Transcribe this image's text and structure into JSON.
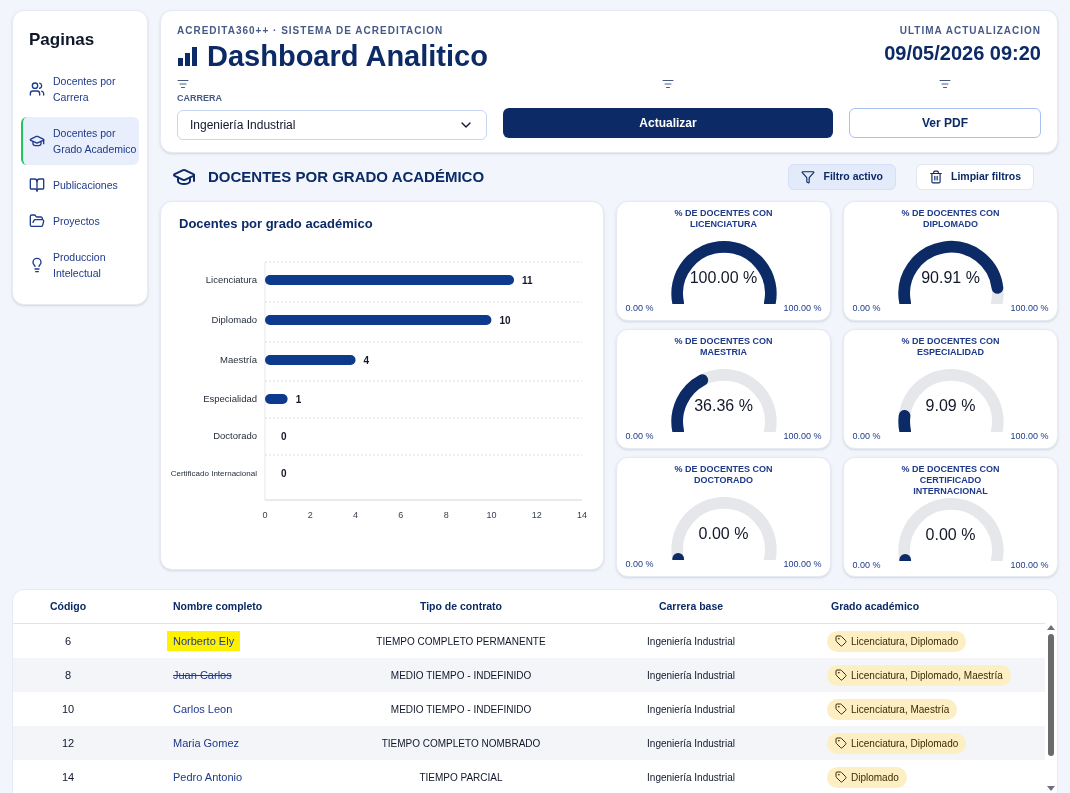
{
  "sidebar": {
    "title": "Paginas",
    "items": [
      {
        "label": "Docentes por Carrera",
        "selected": false
      },
      {
        "label": "Docentes por Grado Academico",
        "selected": true
      },
      {
        "label": "Publicaciones",
        "selected": false
      },
      {
        "label": "Proyectos",
        "selected": false
      },
      {
        "label": "Produccion Intelectual",
        "selected": false
      }
    ]
  },
  "header": {
    "subtitle": "ACREDITA360++ · SISTEMA DE ACREDITACION",
    "title": "Dashboard Analitico",
    "update_label": "ULTIMA ACTUALIZACION",
    "update_value": "09/05/2026 09:20",
    "filter_label": "CARRERA",
    "filter_value": "Ingeniería Industrial",
    "buttons": [
      {
        "label": "Actualizar",
        "kind": "primary"
      },
      {
        "label": "Ver PDF",
        "kind": "outline"
      }
    ]
  },
  "section": {
    "title": "DOCENTES POR GRADO ACADÉMICO",
    "buttons": [
      {
        "label": "Filtro activo",
        "kind": "filter",
        "selected": true
      },
      {
        "label": "Limpiar filtros",
        "kind": "trash",
        "selected": false
      }
    ]
  },
  "bar_chart": {
    "chart_data": {
      "type": "bar",
      "title": "Docentes por grado académico",
      "orientation": "horizontal",
      "categories": [
        "Licenciatura",
        "Diplomado",
        "Maestría",
        "Especialidad",
        "Doctorado",
        "Certificado Internacional"
      ],
      "series": [
        {
          "color": "#0d3a8c",
          "values": [
            11,
            10,
            4,
            1,
            0,
            0
          ]
        }
      ],
      "xlim": [
        0,
        14
      ],
      "xticks": [
        0,
        2,
        4,
        6,
        8,
        10,
        12,
        14
      ],
      "data_labels": true
    }
  },
  "gauges": [
    {
      "title": "% DE DOCENTES CON LICENCIATURA",
      "value": "100.00 %",
      "min": "0.00 %",
      "max": "100.00 %"
    },
    {
      "title": "% DE DOCENTES CON DIPLOMADO",
      "value": "90.91 %",
      "min": "0.00 %",
      "max": "100.00 %"
    },
    {
      "title": "% DE DOCENTES CON MAESTRIA",
      "value": "36.36 %",
      "min": "0.00 %",
      "max": "100.00 %"
    },
    {
      "title": "% DE DOCENTES CON ESPECIALIDAD",
      "value": "9.09 %",
      "min": "0.00 %",
      "max": "100.00 %"
    },
    {
      "title": "% DE DOCENTES CON DOCTORADO",
      "value": "0.00 %",
      "min": "0.00 %",
      "max": "100.00 %"
    },
    {
      "title": "% DE DOCENTES CON CERTIFICADO INTERNACIONAL",
      "value": "0.00 %",
      "min": "0.00 %",
      "max": "100.00 %"
    }
  ],
  "table": {
    "columns": [
      "Código",
      "Nombre completo",
      "Tipo de contrato",
      "Carrera base",
      "Grado académico"
    ],
    "rows": [
      {
        "code": "6",
        "name": "Norberto Ely",
        "highlighted": true,
        "struck": false,
        "contract": "TIEMPO COMPLETO PERMANENTE",
        "career": "Ingeniería Industrial",
        "degrees": "Licenciatura, Diplomado"
      },
      {
        "code": "8",
        "name": "Juan Carlos",
        "highlighted": false,
        "struck": true,
        "contract": "MEDIO TIEMPO - INDEFINIDO",
        "career": "Ingeniería Industrial",
        "degrees": "Licenciatura, Diplomado, Maestría"
      },
      {
        "code": "10",
        "name": "Carlos Leon",
        "highlighted": false,
        "struck": false,
        "contract": "MEDIO TIEMPO - INDEFINIDO",
        "career": "Ingeniería Industrial",
        "degrees": "Licenciatura, Maestría"
      },
      {
        "code": "12",
        "name": "Maria Gomez",
        "highlighted": false,
        "struck": false,
        "contract": "TIEMPO COMPLETO NOMBRADO",
        "career": "Ingeniería Industrial",
        "degrees": "Licenciatura, Diplomado"
      },
      {
        "code": "14",
        "name": "Pedro Antonio",
        "highlighted": false,
        "struck": false,
        "contract": "TIEMPO PARCIAL",
        "career": "Ingeniería Industrial",
        "degrees": "Diplomado"
      }
    ]
  }
}
